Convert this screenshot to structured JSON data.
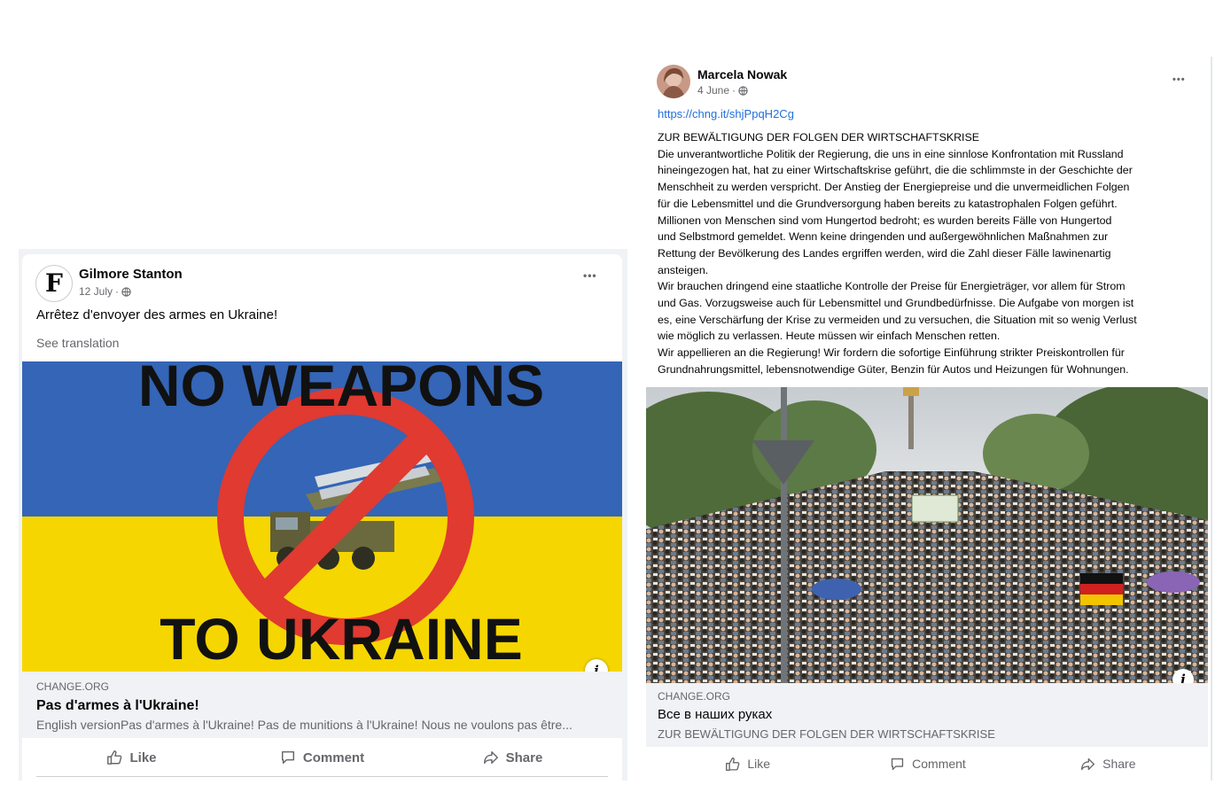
{
  "post1": {
    "author": "Gilmore Stanton",
    "date": "12 July",
    "meta_sep": "·",
    "privacy_icon": "globe-icon",
    "menu": "•••",
    "avatar_glyph": "F",
    "text": "Arrêtez d'envoyer des armes en Ukraine!",
    "see_translation": "See translation",
    "image": {
      "top_text": "NO WEAPONS",
      "bottom_text": "TO UKRAINE",
      "flag_colors": [
        "#3465b6",
        "#f6d600"
      ]
    },
    "info_label": "i",
    "link": {
      "domain": "CHANGE.ORG",
      "title": "Pas d'armes à l'Ukraine!",
      "description": "English versionPas d'armes à l'Ukraine! Pas de munitions à l'Ukraine! Nous ne voulons pas être..."
    },
    "actions": {
      "like": "Like",
      "comment": "Comment",
      "share": "Share"
    }
  },
  "post2": {
    "author": "Marcela Nowak",
    "date": "4 June",
    "meta_sep": "·",
    "privacy_icon": "globe-icon",
    "menu": "•••",
    "url": "https://chng.it/shjPpqH2Cg",
    "body_lines": [
      "ZUR BEWÄLTIGUNG DER FOLGEN DER WIRTSCHAFTSKRISE",
      "Die unverantwortliche Politik der Regierung, die uns in eine sinnlose Konfrontation mit Russland",
      "hineingezogen hat, hat zu einer Wirtschaftskrise geführt, die die schlimmste in der Geschichte der",
      "Menschheit zu werden verspricht. Der Anstieg der Energiepreise und die unvermeidlichen Folgen",
      "für die Lebensmittel und die Grundversorgung haben bereits zu katastrophalen Folgen geführt.",
      "Millionen von Menschen sind vom Hungertod bedroht; es wurden bereits Fälle von Hungertod",
      "und Selbstmord gemeldet. Wenn keine dringenden und außergewöhnlichen Maßnahmen zur",
      "Rettung der Bevölkerung des Landes ergriffen werden, wird die Zahl dieser Fälle lawinenartig",
      "ansteigen.",
      "Wir brauchen dringend eine staatliche Kontrolle der Preise für Energieträger, vor allem für Strom",
      "und Gas. Vorzugsweise auch für Lebensmittel und Grundbedürfnisse. Die Aufgabe von morgen ist",
      "es, eine Verschärfung der Krise zu vermeiden und zu versuchen, die Situation mit so wenig Verlust",
      "wie möglich zu verlassen. Heute müssen wir einfach Menschen retten.",
      "Wir appellieren an die Regierung! Wir fordern die sofortige Einführung strikter Preiskontrollen für",
      "Grundnahrungsmittel, lebensnotwendige Güter, Benzin für Autos und Heizungen für Wohnungen."
    ],
    "info_label": "i",
    "link": {
      "domain": "CHANGE.ORG",
      "title": "Все в наших руках",
      "description": "ZUR BEWÄLTIGUNG DER FOLGEN DER WIRTSCHAFTSKRISE"
    },
    "actions": {
      "like": "Like",
      "comment": "Comment",
      "share": "Share"
    }
  }
}
